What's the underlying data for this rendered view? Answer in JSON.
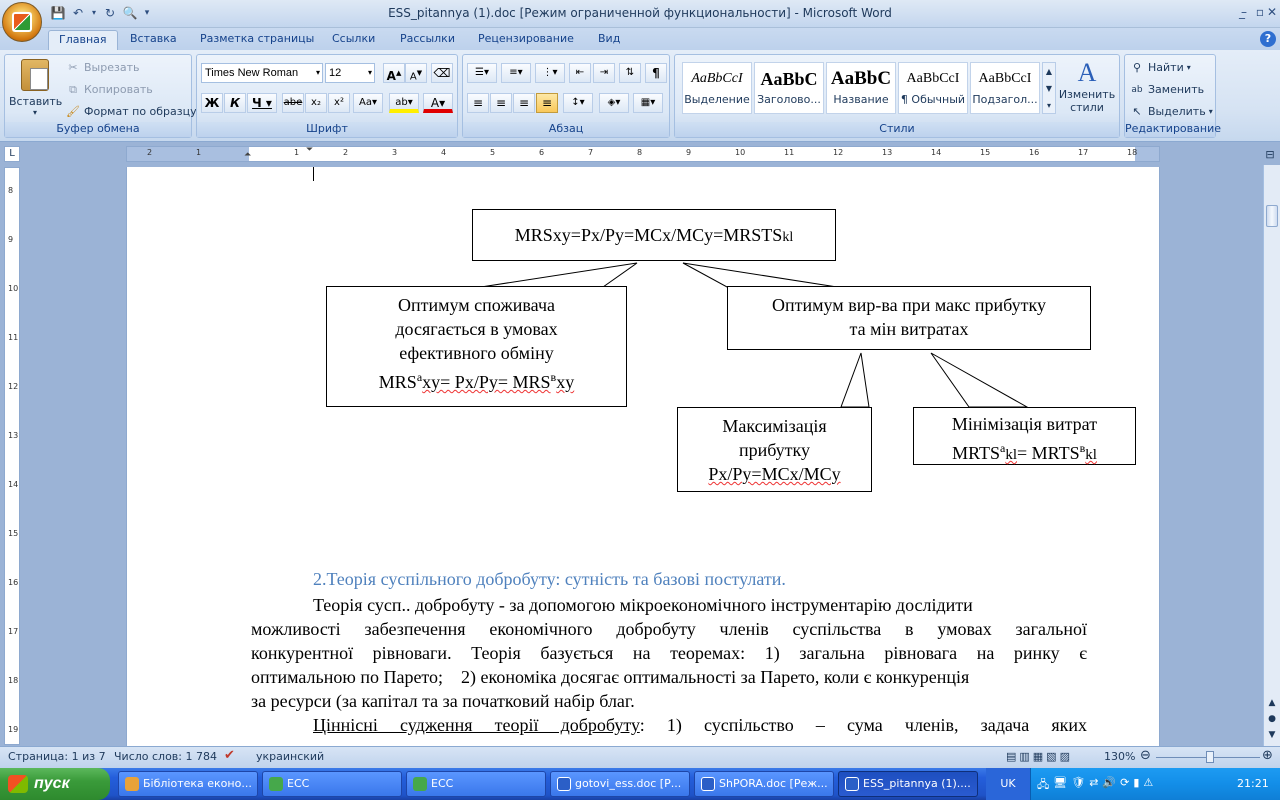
{
  "window": {
    "title": "ESS_pitannya (1).doc [Режим ограниченной функциональности] - Microsoft Word"
  },
  "tabs": [
    "Главная",
    "Вставка",
    "Разметка страницы",
    "Ссылки",
    "Рассылки",
    "Рецензирование",
    "Вид"
  ],
  "clipboard": {
    "paste": "Вставить",
    "cut": "Вырезать",
    "copy": "Копировать",
    "format_painter": "Формат по образцу",
    "label": "Буфер обмена"
  },
  "font": {
    "name": "Times New Roman",
    "size": "12",
    "label": "Шрифт"
  },
  "paragraph": {
    "label": "Абзац"
  },
  "styles": {
    "items": [
      {
        "sample": "AaBbCcI",
        "name": "Выделение"
      },
      {
        "sample": "AaBbC",
        "name": "Заголово..."
      },
      {
        "sample": "AaBbC",
        "name": "Название"
      },
      {
        "sample": "AaBbCcI",
        "name": "¶ Обычный"
      },
      {
        "sample": "AaBbCcI",
        "name": "Подзагол..."
      }
    ],
    "change": "Изменить стили",
    "label": "Стили"
  },
  "editing": {
    "find": "Найти",
    "replace": "Заменить",
    "select": "Выделить",
    "label": "Редактирование"
  },
  "diagram": {
    "top": "MRSxy=Px/Py=MCx/MCy=MRSTS",
    "top_sub": "kl",
    "left_lines": [
      "Оптимум споживача",
      "досягається в умовах",
      "ефективного обміну"
    ],
    "left_formula_a": "MRS",
    "left_formula_sup_a": "а",
    "left_formula_mid": "xy= Px/Py= MRS",
    "left_formula_sup_b": "в",
    "left_formula_end": "xy",
    "right_lines": [
      "Оптимум вир-ва при макс прибутку",
      "та мін витратах"
    ],
    "max_lines": [
      "Максимізація",
      "прибутку",
      "Px/Py=MCx/MCy"
    ],
    "min_line": "Мінімізація витрат",
    "min_formula_a": "MRTS",
    "min_formula_sup_a": "а",
    "min_formula_sub_a": "kl",
    "min_formula_mid": "= MRTS",
    "min_formula_sup_b": "в",
    "min_formula_sub_b": "kl"
  },
  "document": {
    "heading": "2.Теорія суспільного добробуту: сутність та базові постулати.",
    "p1_lines": [
      "Теорія сусп.. добробуту - за допомогою мікроекономічного інструментарію дослідити",
      "можливості забезпечення економічного добробуту членів суспільства в умовах загальної",
      "конкурентної рівноваги. Теорія базується на теоремах: 1) загальна рівновага на ринку є",
      "оптимальною по Парето;    2) економіка досягає оптимальності за Парето, коли є конкуренція",
      "за ресурси (за капітал та за початковий набір благ."
    ],
    "p2_underlined": "Ціннісні судження теорії добробуту",
    "p2_rest": ": 1) суспільство – сума членів, задача яких"
  },
  "status": {
    "page": "Страница: 1 из 7",
    "words": "Число слов: 1 784",
    "lang": "украинский",
    "zoom": "130%"
  },
  "taskbar": {
    "start": "пуск",
    "items": [
      {
        "label": "Бібліотека еконо...",
        "color": "#e8a23a"
      },
      {
        "label": "ЕСС",
        "color": "#46a84b"
      },
      {
        "label": "ЕСС",
        "color": "#46a84b"
      },
      {
        "label": "gotovi_ess.doc [Р...",
        "color": "#2b5fc7"
      },
      {
        "label": "ShPORA.doc [Реж...",
        "color": "#2b5fc7"
      },
      {
        "label": "ESS_pitannya (1)....",
        "color": "#2b5fc7"
      }
    ],
    "lang": "UK",
    "clock": "21:21"
  }
}
